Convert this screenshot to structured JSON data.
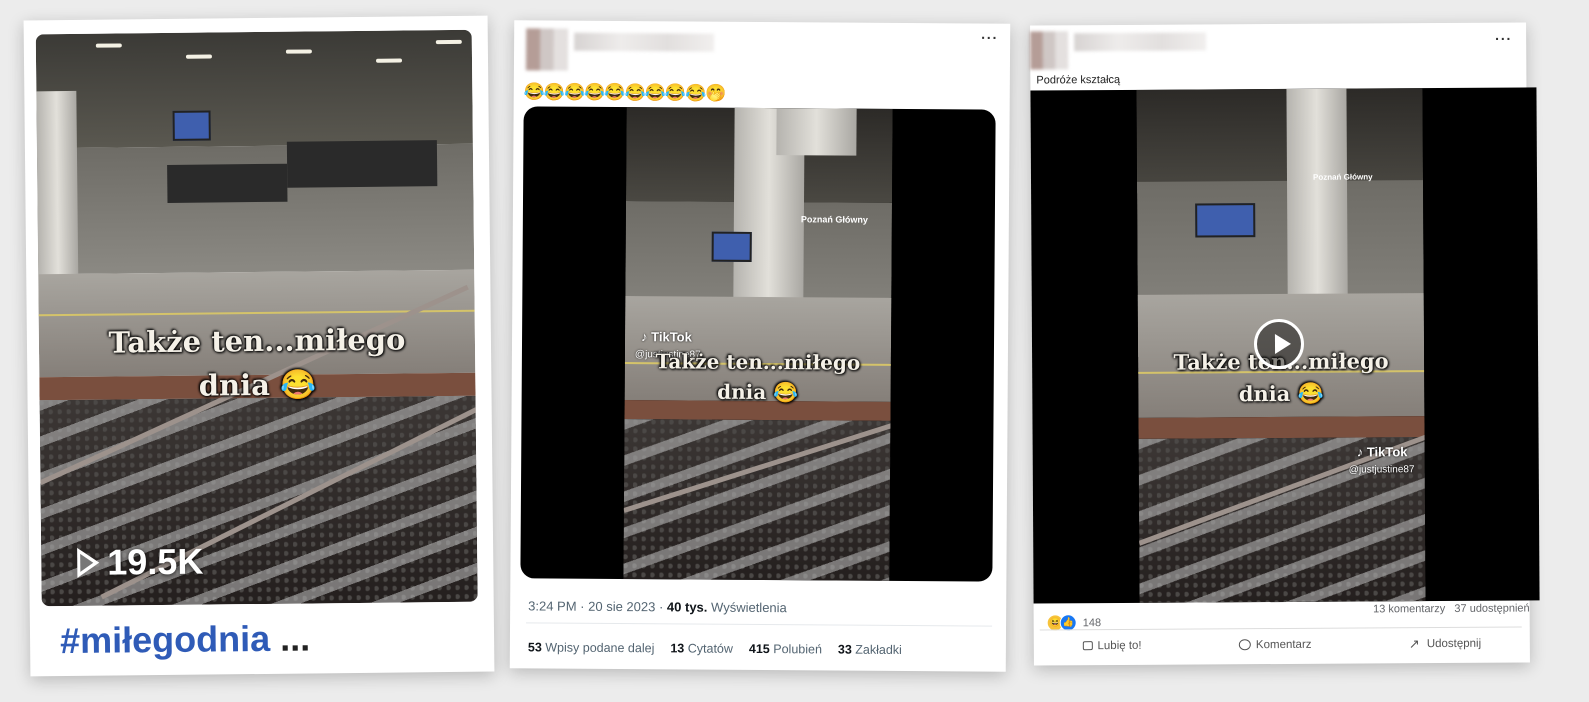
{
  "tiktok_card": {
    "overlay_line1": "Także ten...miłego",
    "overlay_line2": "dnia 😂",
    "views": "19.5K",
    "hashtag": "#miłegodnia",
    "ellipsis": "..."
  },
  "x_post": {
    "more": "···",
    "emoji_text": "😂😂😂😂😂😂😂😂😂🤭",
    "overlay_line1": "Także ten...miłego",
    "overlay_line2": "dnia 😂",
    "station_sign": "Poznań Główny",
    "tiktok_label": "TikTok",
    "tiktok_user": "@justjustine87",
    "time": "3:24 PM",
    "date": "20 sie 2023",
    "views_count": "40 tys.",
    "views_label": "Wyświetlenia",
    "stats": [
      {
        "count": "53",
        "label": "Wpisy podane dalej"
      },
      {
        "count": "13",
        "label": "Cytatów"
      },
      {
        "count": "415",
        "label": "Polubień"
      },
      {
        "count": "33",
        "label": "Zakładki"
      }
    ]
  },
  "fb_post": {
    "more": "···",
    "caption": "Podróże kształcą",
    "overlay_line1": "Także ten...miłego",
    "overlay_line2": "dnia 😂",
    "station_sign": "Poznań Główny",
    "tiktok_label": "TikTok",
    "tiktok_user": "@justjustine87",
    "reactions_count": "148",
    "comments": "13 komentarzy",
    "shares": "37 udostępnień",
    "actions": {
      "like": "Lubię to!",
      "comment": "Komentarz",
      "share": "Udostępnij"
    }
  },
  "colors": {
    "hashtag": "#2f5bb7",
    "fb_like": "#1877f2",
    "haha": "#f7c33a"
  }
}
